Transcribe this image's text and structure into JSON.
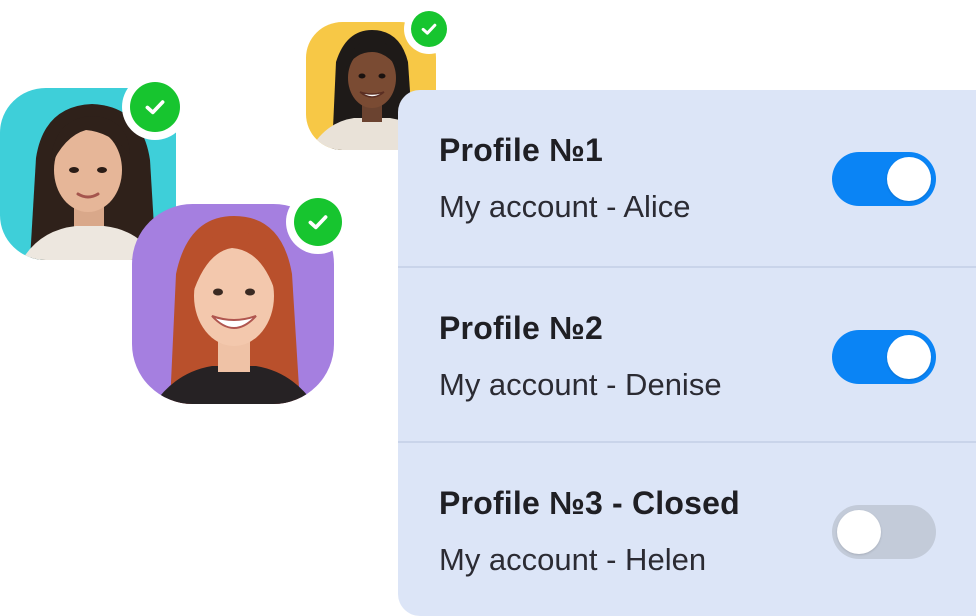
{
  "profiles": [
    {
      "title": "Profile №1",
      "subtitle": "My account - Alice",
      "enabled": true
    },
    {
      "title": "Profile №2",
      "subtitle": "My account - Denise",
      "enabled": true
    },
    {
      "title": "Profile №3 - Closed",
      "subtitle": "My account - Helen",
      "enabled": false
    }
  ],
  "avatars": [
    {
      "person": "Alice",
      "background": "#3ecfd9",
      "verified": true
    },
    {
      "person": "Denise",
      "background": "#f7c846",
      "verified": true
    },
    {
      "person": "Helen",
      "background": "#a57fe0",
      "verified": true
    }
  ],
  "colors": {
    "panel_bg": "#dce5f7",
    "toggle_on": "#0a84f5",
    "toggle_off": "#c3cbd9",
    "check_badge": "#17c52f"
  },
  "icons": {
    "badge": "check-circle-icon"
  }
}
